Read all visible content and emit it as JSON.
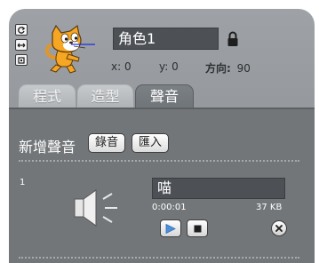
{
  "sprite": {
    "name": "角色1",
    "x_label": "x: 0",
    "y_label": "y: 0",
    "direction_label": "方向:",
    "direction_value": "90"
  },
  "tabs": [
    {
      "label": "程式",
      "active": false
    },
    {
      "label": "造型",
      "active": false
    },
    {
      "label": "聲音",
      "active": true
    }
  ],
  "sounds_panel": {
    "new_sound_label": "新增聲音",
    "record_button": "錄音",
    "import_button": "匯入"
  },
  "sounds": [
    {
      "index": "1",
      "name": "喵",
      "duration": "0:00:01",
      "size": "37 KB"
    }
  ],
  "colors": {
    "panel": "#727679",
    "active_tab": "#7b8084",
    "play_icon": "#4f8fd6"
  },
  "icons": [
    "rotate-all-around-icon",
    "left-right-flip-icon",
    "dont-rotate-icon",
    "lock-icon",
    "speaker-icon",
    "play-icon",
    "stop-icon",
    "delete-icon"
  ]
}
